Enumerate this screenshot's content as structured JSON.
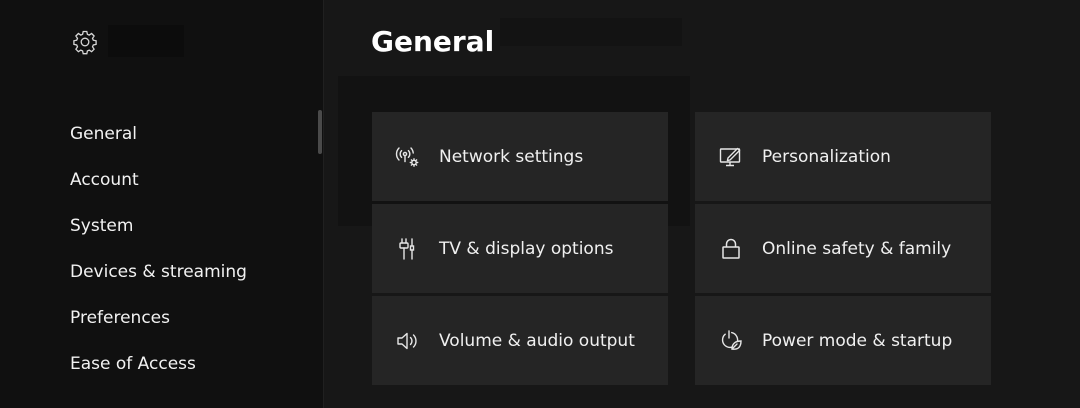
{
  "sidebar": {
    "icon": "gear-icon",
    "items": [
      {
        "label": "General"
      },
      {
        "label": "Account"
      },
      {
        "label": "System"
      },
      {
        "label": "Devices & streaming"
      },
      {
        "label": "Preferences"
      },
      {
        "label": "Ease of Access"
      }
    ]
  },
  "main": {
    "title": "General",
    "tiles": [
      {
        "label": "Network settings",
        "icon": "network-icon"
      },
      {
        "label": "Personalization",
        "icon": "personalization-icon"
      },
      {
        "label": "TV & display options",
        "icon": "hdmi-cable-icon"
      },
      {
        "label": "Online safety & family",
        "icon": "lock-icon"
      },
      {
        "label": "Volume & audio output",
        "icon": "speaker-icon"
      },
      {
        "label": "Power mode & startup",
        "icon": "power-leaf-icon"
      }
    ]
  },
  "colors": {
    "background": "#161616",
    "sidebar": "#101010",
    "tile": "#252525",
    "text": "#f0f0f0"
  }
}
